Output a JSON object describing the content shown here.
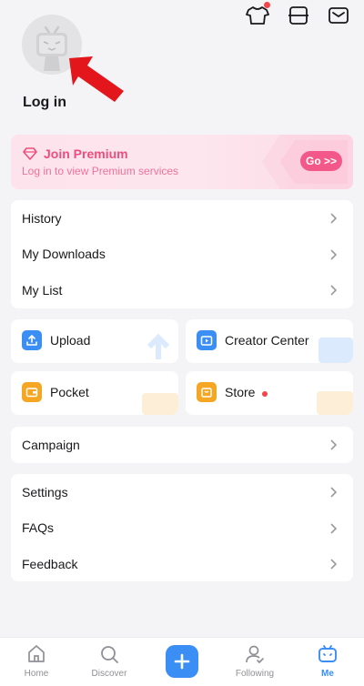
{
  "header": {
    "icons": [
      "tshirt-icon",
      "scan-icon",
      "message-icon"
    ],
    "notification_color": "#f5454a"
  },
  "profile": {
    "login_label": "Log in"
  },
  "premium": {
    "title": "Join Premium",
    "subtitle": "Log in to view Premium services",
    "go_label": "Go >>",
    "accent": "#ee4e7e"
  },
  "menu1": {
    "items": [
      {
        "label": "History"
      },
      {
        "label": "My Downloads"
      },
      {
        "label": "My List"
      }
    ]
  },
  "tiles": {
    "upload": {
      "label": "Upload",
      "color": "#3b8ef3"
    },
    "creator": {
      "label": "Creator Center",
      "color": "#3b8ef3"
    },
    "pocket": {
      "label": "Pocket",
      "color": "#f5a623"
    },
    "store": {
      "label": "Store",
      "color": "#f5a623"
    }
  },
  "menu2": {
    "items": [
      {
        "label": "Campaign"
      }
    ]
  },
  "menu3": {
    "items": [
      {
        "label": "Settings"
      },
      {
        "label": "FAQs"
      },
      {
        "label": "Feedback"
      }
    ]
  },
  "nav": {
    "items": [
      {
        "label": "Home"
      },
      {
        "label": "Discover"
      },
      {
        "label": ""
      },
      {
        "label": "Following"
      },
      {
        "label": "Me"
      }
    ],
    "active_color": "#3b8ef3"
  }
}
